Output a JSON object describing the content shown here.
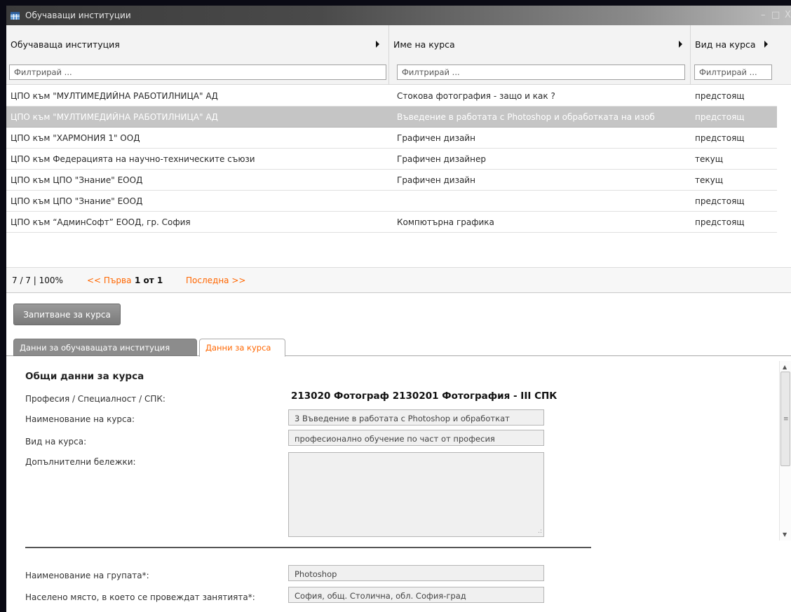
{
  "window": {
    "title": "Обучаващи институции"
  },
  "grid": {
    "columns": [
      {
        "label": "Обучаваща институция",
        "filter_placeholder": "Филтрирай ..."
      },
      {
        "label": "Име на курса",
        "filter_placeholder": "Филтрирай ..."
      },
      {
        "label": "Вид на курса",
        "filter_placeholder": "Филтрирай ..."
      }
    ],
    "rows": [
      {
        "institution": "ЦПО към \"МУЛТИМЕДИЙНА РАБОТИЛНИЦА\" АД",
        "course": "Стокова фотография - защо и как ?",
        "type": "предстоящ"
      },
      {
        "institution": "ЦПО към \"МУЛТИМЕДИЙНА РАБОТИЛНИЦА\" АД",
        "course": "Въведение в работата с Photoshop и обработката на изоб",
        "type": "предстоящ",
        "selected": true
      },
      {
        "institution": "ЦПО към \"ХАРМОНИЯ 1\" ООД",
        "course": "Графичен дизайн",
        "type": "предстоящ"
      },
      {
        "institution": "ЦПО към Федерацията на научно-техническите съюзи",
        "course": "Графичен дизайнер",
        "type": "текущ"
      },
      {
        "institution": "ЦПО към ЦПО \"Знание\" ЕООД",
        "course": "Графичен дизайн",
        "type": "текущ"
      },
      {
        "institution": "ЦПО към ЦПО \"Знание\" ЕООД",
        "course": "",
        "type": "предстоящ"
      },
      {
        "institution": "ЦПО към “АдминСофт” ЕООД, гр. София",
        "course": "Компютърна графика",
        "type": "предстоящ"
      }
    ],
    "pager": {
      "count": "7 / 7 | 100%",
      "first": "<< Първа",
      "page": "1 от 1",
      "last": "Последна >>"
    }
  },
  "actions": {
    "inquire_label": "Запитване за курса"
  },
  "tabs": [
    {
      "label": "Данни за обучаващата институция",
      "active": false
    },
    {
      "label": "Данни за курса",
      "active": true
    }
  ],
  "details": {
    "section_title": "Общи данни за курса",
    "profession_label": "Професия / Специалност / СПК:",
    "profession_value": "213020 Фотограф 2130201 Фотография - III СПК",
    "course_name_label": "Наименование на курса:",
    "course_name_value": "3 Въведение в работата с Photoshop и обработкат",
    "course_type_label": "Вид на курса:",
    "course_type_value": "професионално обучение по част от професия",
    "notes_label": "Допълнителни бележки:",
    "notes_value": "",
    "group_name_label": "Наименование на групата*:",
    "group_name_value": "Photoshop",
    "location_label": "Населено място, в което се провеждат занятията*:",
    "location_value": "София, общ. Столична, обл. София-град"
  },
  "colors": {
    "accent": "#ff6600",
    "selected_row": "#c5c5c5",
    "titlebar": "#3b3b3b"
  }
}
